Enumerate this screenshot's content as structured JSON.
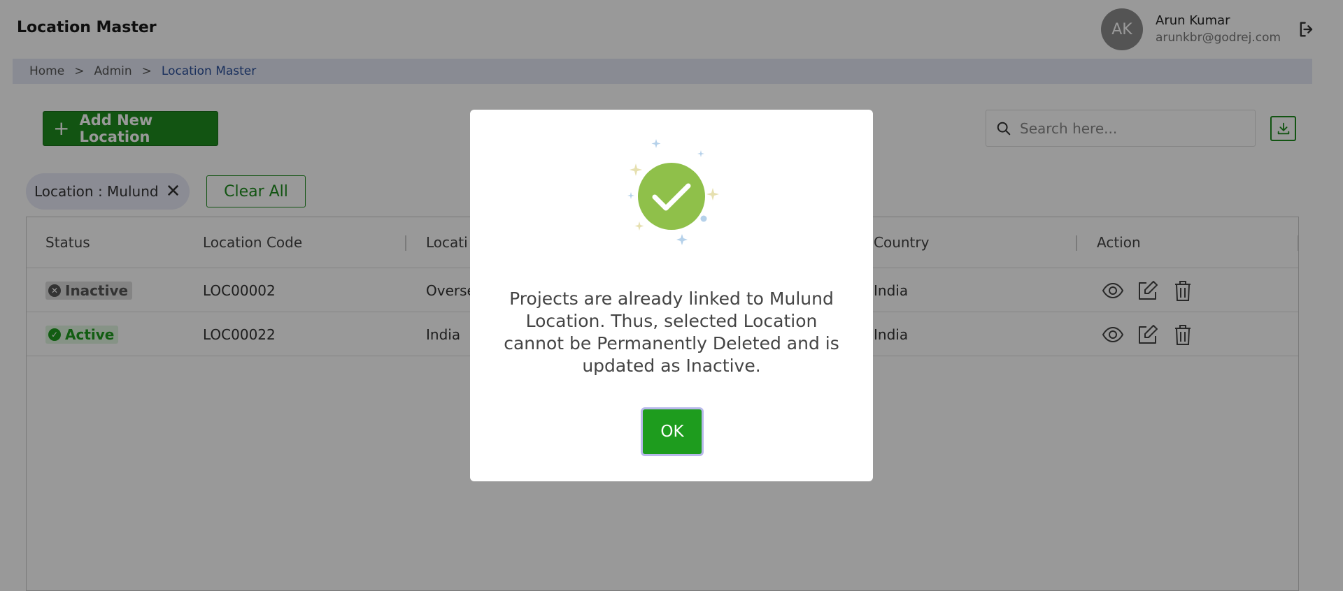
{
  "header": {
    "title": "Location Master",
    "user_initials": "AK",
    "user_name": "Arun Kumar",
    "user_email": "arunkbr@godrej.com"
  },
  "breadcrumb": {
    "items": [
      "Home",
      "Admin",
      "Location Master"
    ],
    "separator": ">"
  },
  "toolbar": {
    "add_label": "Add New Location",
    "search_placeholder": "Search here..."
  },
  "filters": {
    "chip_label": "Location : Mulund",
    "clear_all": "Clear All"
  },
  "table": {
    "columns": [
      "Status",
      "Location Code",
      "Locati",
      "Country",
      "Action"
    ],
    "rows": [
      {
        "status": "Inactive",
        "code": "LOC00002",
        "location": "Overse",
        "country": "India"
      },
      {
        "status": "Active",
        "code": "LOC00022",
        "location": "India",
        "country": "India"
      }
    ]
  },
  "modal": {
    "message": "Projects are already linked to Mulund Location. Thus, selected Location cannot be Permanently Deleted and is updated as Inactive.",
    "ok_label": "OK"
  },
  "colors": {
    "primary_green": "#1e8c1e",
    "success_circle": "#8fc04a",
    "breadcrumb_active": "#2a4f9a"
  },
  "icons": [
    "logout-icon",
    "search-icon",
    "download-icon",
    "close-icon",
    "eye-icon",
    "edit-icon",
    "delete-icon",
    "check-icon"
  ]
}
